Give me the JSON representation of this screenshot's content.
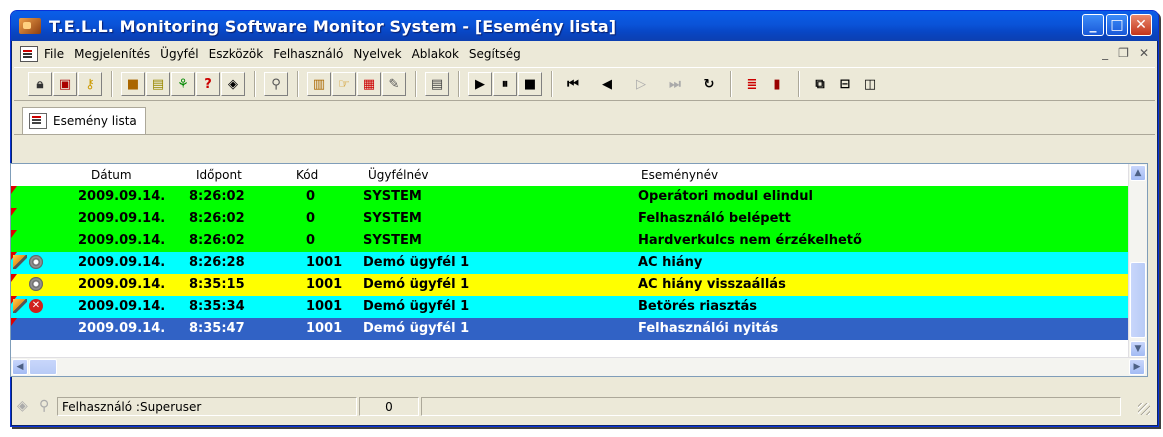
{
  "window": {
    "title": "T.E.L.L. Monitoring Software Monitor System - [Esemény lista]"
  },
  "menu": [
    "File",
    "Megjelenítés",
    "Ügyfél",
    "Eszközök",
    "Felhasználó",
    "Nyelvek",
    "Ablakok",
    "Segítség"
  ],
  "toolbar_icons": [
    "lock-icon",
    "ban-icon",
    "key-icon",
    "gift-icon",
    "cards-icon",
    "runner-icon",
    "help-icon",
    "warning-icon",
    "wand-icon",
    "building-icon",
    "hand-icon",
    "table-icon",
    "pen-icon",
    "document-icon",
    "play-icon",
    "pause-icon",
    "stop-icon",
    "first-icon",
    "prev-icon",
    "next-icon",
    "last-icon",
    "refresh-icon",
    "list-icon",
    "book-icon",
    "cascade-icon",
    "tile-horizontal-icon",
    "tile-vertical-icon"
  ],
  "tab": {
    "label": "Esemény lista"
  },
  "columns": {
    "date": "Dátum",
    "time": "Időpont",
    "code": "Kód",
    "client": "Ügyfélnév",
    "event": "Eseménynév"
  },
  "rows": [
    {
      "date": "2009.09.14.",
      "time": "8:26:02",
      "code": "0",
      "client": "SYSTEM",
      "event": "Operátori modul elindul",
      "bg": "#00ff00",
      "fg": "#000000",
      "icons": []
    },
    {
      "date": "2009.09.14.",
      "time": "8:26:02",
      "code": "0",
      "client": "SYSTEM",
      "event": "Felhasználó belépett",
      "bg": "#00ff00",
      "fg": "#000000",
      "icons": []
    },
    {
      "date": "2009.09.14.",
      "time": "8:26:02",
      "code": "0",
      "client": "SYSTEM",
      "event": "Hardverkulcs nem érzékelhető",
      "bg": "#00ff00",
      "fg": "#000000",
      "icons": []
    },
    {
      "date": "2009.09.14.",
      "time": "8:26:28",
      "code": "1001",
      "client": "Demó ügyfél 1",
      "event": "AC hiány",
      "bg": "#00ffff",
      "fg": "#000000",
      "icons": [
        "pencil",
        "gear"
      ]
    },
    {
      "date": "2009.09.14.",
      "time": "8:35:15",
      "code": "1001",
      "client": "Demó ügyfél 1",
      "event": "AC hiány visszaállás",
      "bg": "#ffff00",
      "fg": "#000000",
      "icons": [
        "gear"
      ]
    },
    {
      "date": "2009.09.14.",
      "time": "8:35:34",
      "code": "1001",
      "client": "Demó ügyfél 1",
      "event": "Betörés riasztás",
      "bg": "#00ffff",
      "fg": "#000000",
      "icons": [
        "pencil",
        "x"
      ]
    },
    {
      "date": "2009.09.14.",
      "time": "8:35:47",
      "code": "1001",
      "client": "Demó ügyfél 1",
      "event": "Felhasználói nyitás",
      "bg": "#3162c5",
      "fg": "#ffffff",
      "icons": []
    }
  ],
  "status": {
    "user": "Felhasználó :Superuser",
    "count": "0"
  }
}
